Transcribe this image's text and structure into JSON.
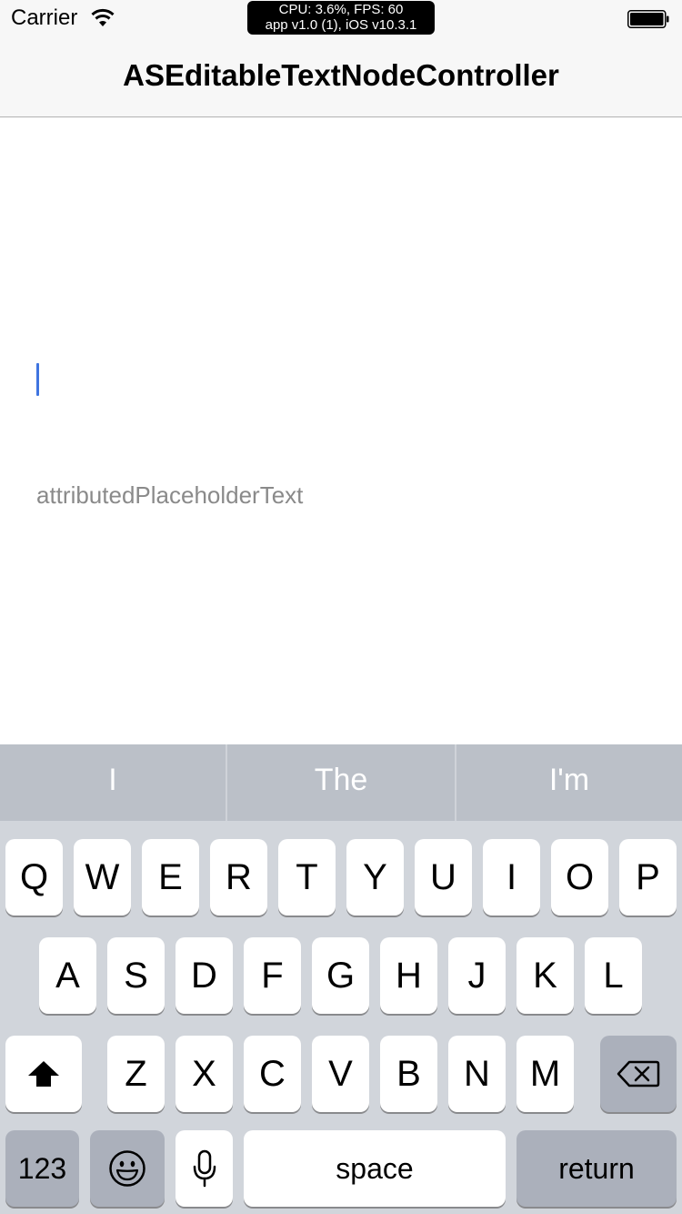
{
  "status_bar": {
    "carrier": "Carrier",
    "perf_line1": "CPU: 3.6%, FPS: 60",
    "perf_line2": "app v1.0 (1), iOS v10.3.1",
    "wifi_icon": "wifi-icon",
    "battery_icon": "battery-icon"
  },
  "nav": {
    "title": "ASEditableTextNodeController"
  },
  "editor": {
    "value": "",
    "placeholder": "attributedPlaceholderText",
    "caret_color": "#3f74e0"
  },
  "keyboard": {
    "suggestions": [
      "I",
      "The",
      "I'm"
    ],
    "row1": [
      "Q",
      "W",
      "E",
      "R",
      "T",
      "Y",
      "U",
      "I",
      "O",
      "P"
    ],
    "row2": [
      "A",
      "S",
      "D",
      "F",
      "G",
      "H",
      "J",
      "K",
      "L"
    ],
    "row3": [
      "Z",
      "X",
      "C",
      "V",
      "B",
      "N",
      "M"
    ],
    "numbers_label": "123",
    "space_label": "space",
    "return_label": "return",
    "shift_icon": "shift-icon",
    "backspace_icon": "backspace-icon",
    "emoji_icon": "emoji-icon",
    "mic_icon": "microphone-icon"
  }
}
